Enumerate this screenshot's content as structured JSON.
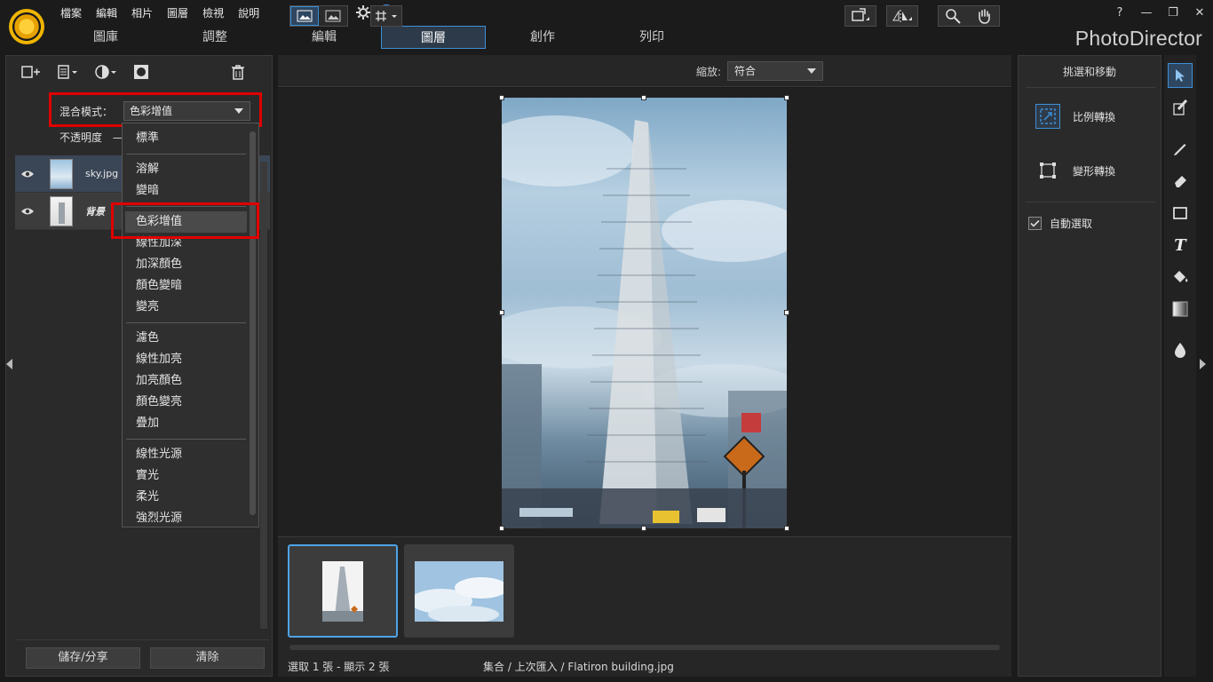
{
  "app": {
    "brand": "PhotoDirector"
  },
  "menu": [
    "檔案",
    "編輯",
    "相片",
    "圖層",
    "檢視",
    "說明"
  ],
  "window_controls": [
    "?",
    "—",
    "❐",
    "✕"
  ],
  "tabs": [
    {
      "label": "圖庫",
      "active": false
    },
    {
      "label": "調整",
      "active": false
    },
    {
      "label": "編輯",
      "active": false
    },
    {
      "label": "圖層",
      "active": true
    },
    {
      "label": "創作",
      "active": false
    },
    {
      "label": "列印",
      "active": false
    }
  ],
  "layers_panel": {
    "blend_label": "混合模式：",
    "blend_value": "色彩增值",
    "opacity_label": "不透明度",
    "opacity_dash": "—",
    "layers": [
      {
        "name": "sky.jpg",
        "selected": true
      },
      {
        "name": "背景",
        "selected": false
      }
    ],
    "save_share_label": "儲存/分享",
    "clear_label": "清除"
  },
  "blend_dropdown": {
    "groups": [
      [
        "標準"
      ],
      [
        "溶解",
        "變暗"
      ],
      [
        "色彩增值",
        "線性加深",
        "加深顏色",
        "顏色變暗",
        "變亮"
      ],
      [
        "濾色",
        "線性加亮",
        "加亮顏色",
        "顏色變亮",
        "疊加"
      ],
      [
        "線性光源",
        "實光",
        "柔光",
        "強烈光源"
      ]
    ],
    "highlighted": "色彩增值"
  },
  "canvas_toolbar": {
    "zoom_label": "縮放:",
    "zoom_value": "符合"
  },
  "status": {
    "selection": "選取 1 張 - 顯示 2 張",
    "path": "集合 / 上次匯入 / Flatiron building.jpg"
  },
  "right_panel": {
    "title": "挑選和移動",
    "scale_transform": "比例轉換",
    "shape_transform": "變形轉換",
    "auto_select": "自動選取",
    "auto_select_checked": true
  },
  "colors": {
    "accent": "#3d8fd6",
    "highlight_box": "#e00000",
    "panel_bg": "#2a2a2a"
  }
}
